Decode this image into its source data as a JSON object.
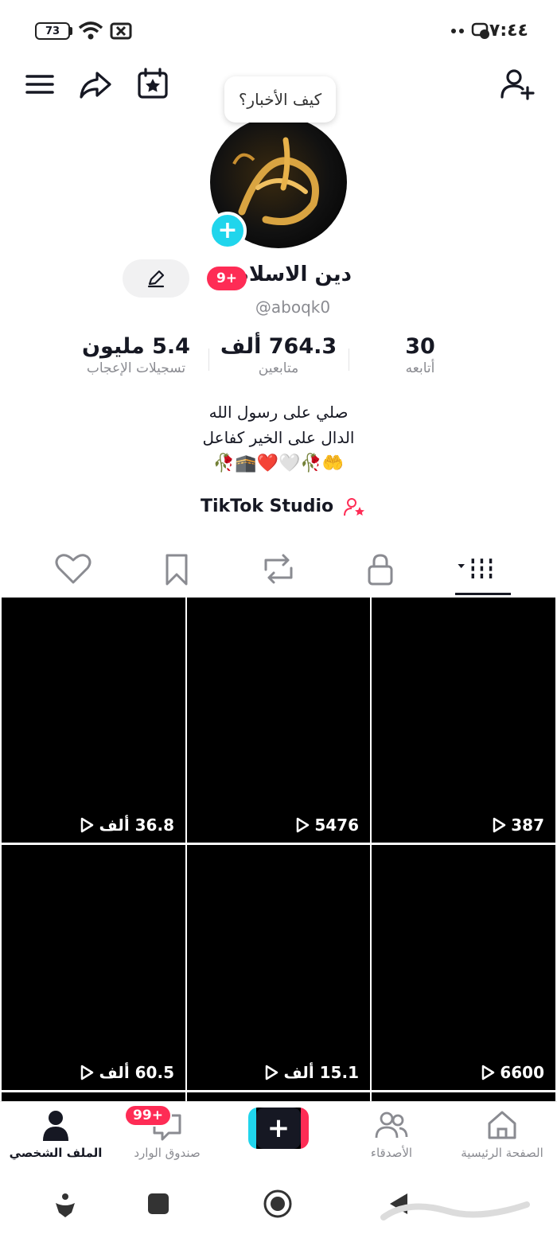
{
  "status_bar": {
    "battery": "73",
    "time": "٧:٤٤"
  },
  "header": {
    "bubble_text": "كيف الأخبار؟"
  },
  "profile": {
    "name": "دين الاسلام",
    "notif_badge": "9+",
    "username": "@aboqk0",
    "stats": [
      {
        "value": "5.4 مليون",
        "label": "تسجيلات الإعجاب"
      },
      {
        "value": "764.3 ألف",
        "label": "متابعين"
      },
      {
        "value": "30",
        "label": "أتابعه"
      }
    ],
    "bio_lines": [
      "صلي على رسول الله",
      "الدال على الخير كفاعل",
      "🤲🥀🤍❤️🕋🥀"
    ],
    "studio_label": "TikTok Studio"
  },
  "tabs": [
    "videos-grid",
    "private",
    "reposts",
    "favorites",
    "liked"
  ],
  "videos": [
    {
      "views": "36.8 ألف"
    },
    {
      "views": "5476"
    },
    {
      "views": "387"
    },
    {
      "views": "60.5 ألف"
    },
    {
      "views": "15.1 ألف"
    },
    {
      "views": "6600"
    }
  ],
  "bottom_nav": {
    "profile": "الملف الشخصي",
    "inbox": "صندوق الوارد",
    "inbox_badge": "99+",
    "friends": "الأصدقاء",
    "home": "الصفحة الرئيسية"
  }
}
